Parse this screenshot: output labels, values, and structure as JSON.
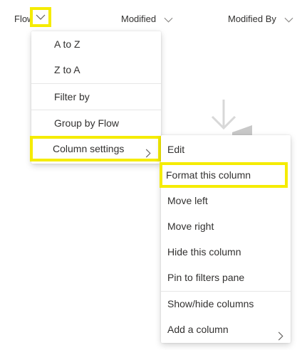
{
  "header": {
    "flow_label": "Flow",
    "modified_label": "Modified",
    "modified_by_label": "Modified By"
  },
  "column_menu": {
    "items": [
      {
        "label": "A to Z"
      },
      {
        "label": "Z to A"
      },
      {
        "label": "Filter by"
      },
      {
        "label": "Group by Flow"
      },
      {
        "label": "Column settings",
        "has_submenu": true,
        "highlighted": true
      }
    ]
  },
  "column_settings_menu": {
    "items": [
      {
        "label": "Edit"
      },
      {
        "label": "Format this column",
        "highlighted": true
      },
      {
        "label": "Move left"
      },
      {
        "label": "Move right"
      },
      {
        "label": "Hide this column"
      },
      {
        "label": "Pin to filters pane"
      },
      {
        "label": "Show/hide columns"
      },
      {
        "label": "Add a column",
        "has_submenu": true
      }
    ]
  },
  "colors": {
    "highlight": "#f5ec00",
    "text": "#323130",
    "chevron": "#605e5c",
    "divider": "#e6e6e6"
  },
  "icons": {
    "chevron_down": "chevron-down-icon",
    "chevron_right": "chevron-right-icon",
    "background_illustration": "download-arrow-illustration"
  }
}
